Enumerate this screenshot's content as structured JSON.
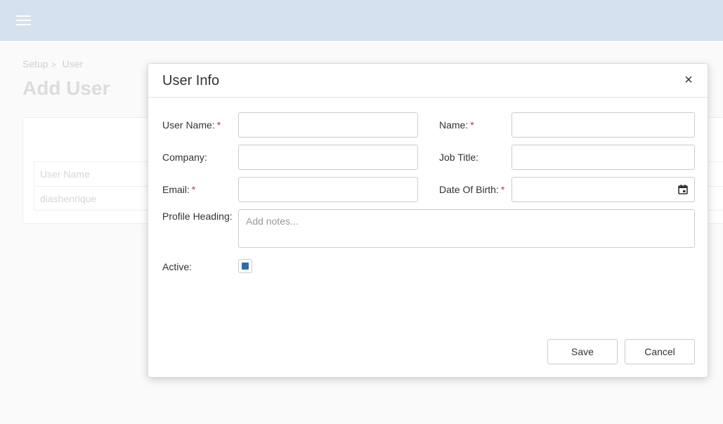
{
  "topbar": {
    "menu_icon": "hamburger-menu-icon"
  },
  "breadcrumb": {
    "items": [
      "Setup",
      "User"
    ],
    "separator": ">"
  },
  "page": {
    "title": "Add User"
  },
  "background_table": {
    "header": "User Name",
    "rows": [
      "diashenrique"
    ]
  },
  "modal": {
    "title": "User Info",
    "close_label": "×",
    "fields": {
      "username": {
        "label": "User Name:",
        "required": "*",
        "value": ""
      },
      "name": {
        "label": "Name:",
        "required": "*",
        "value": ""
      },
      "company": {
        "label": "Company:",
        "value": ""
      },
      "job_title": {
        "label": "Job Title:",
        "value": ""
      },
      "email": {
        "label": "Email:",
        "required": "*",
        "value": ""
      },
      "dob": {
        "label": "Date Of Birth:",
        "required": "*",
        "value": "",
        "icon": "calendar-icon"
      },
      "profile_heading": {
        "label": "Profile Heading:",
        "placeholder": "Add notes..."
      },
      "active": {
        "label": "Active:",
        "checked": true
      }
    },
    "buttons": {
      "save": "Save",
      "cancel": "Cancel"
    }
  },
  "colors": {
    "topbar": "#d5e1ee",
    "accent": "#2e6da4",
    "required": "#c0392b"
  }
}
